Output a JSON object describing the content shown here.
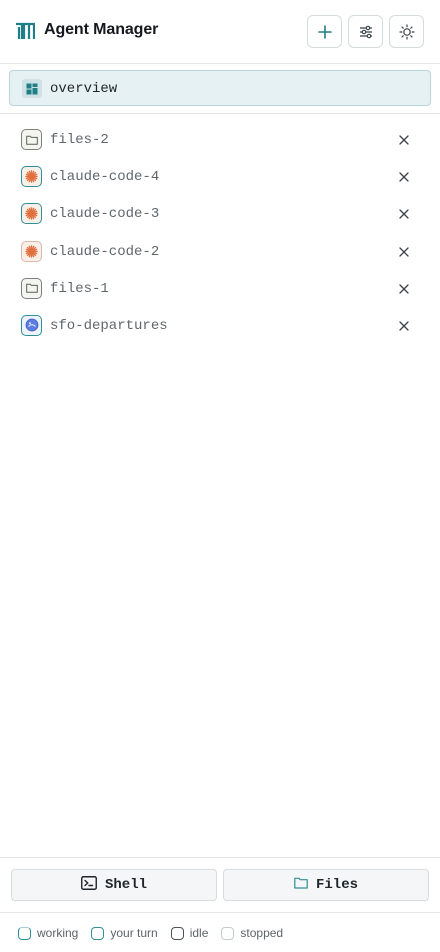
{
  "header": {
    "title": "Agent Manager",
    "logo_icon": "agent-manager-logo",
    "buttons": [
      {
        "name": "new-session",
        "icon": "plus-icon"
      },
      {
        "name": "settings",
        "icon": "sliders-icon"
      },
      {
        "name": "theme-toggle",
        "icon": "sun-icon"
      }
    ]
  },
  "overview": {
    "label": "overview",
    "icon": "dashboard-icon",
    "selected": true
  },
  "sessions": [
    {
      "label": "files-2",
      "icon": "folder-icon",
      "status": "idle"
    },
    {
      "label": "claude-code-4",
      "icon": "claude-icon",
      "status": "your turn"
    },
    {
      "label": "claude-code-3",
      "icon": "claude-icon",
      "status": "your turn"
    },
    {
      "label": "claude-code-2",
      "icon": "claude-icon",
      "status": "stopped"
    },
    {
      "label": "files-1",
      "icon": "folder-icon",
      "status": "idle"
    },
    {
      "label": "sfo-departures",
      "icon": "browser-icon",
      "status": "your turn"
    }
  ],
  "footer": {
    "shell_label": "Shell",
    "files_label": "Files"
  },
  "legend": [
    {
      "label": "working",
      "color": "#2f8f96"
    },
    {
      "label": "your turn",
      "color": "#2f8f96"
    },
    {
      "label": "idle",
      "color": "#4c5257"
    },
    {
      "label": "stopped",
      "color": "#c4c9cc"
    }
  ],
  "colors": {
    "accent": "#2f8f96",
    "selected_bg": "#e6f1f3",
    "claude_orange": "#e0703f"
  }
}
